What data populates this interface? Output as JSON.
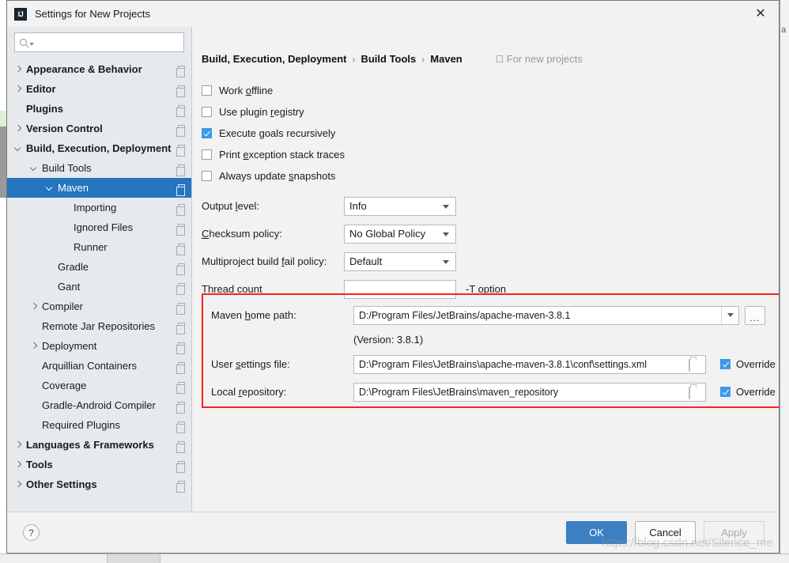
{
  "window": {
    "title": "Settings for New Projects",
    "logo_text": "IJ",
    "close_label": "✕"
  },
  "sidebar": {
    "search": {
      "placeholder": "",
      "value": "",
      "icon": "search-icon"
    },
    "items": [
      {
        "label": "Appearance & Behavior",
        "indent": 0,
        "twisty": "collapsed",
        "bold": true,
        "selected": false
      },
      {
        "label": "Editor",
        "indent": 0,
        "twisty": "collapsed",
        "bold": true,
        "selected": false
      },
      {
        "label": "Plugins",
        "indent": 0,
        "twisty": "none",
        "bold": true,
        "selected": false
      },
      {
        "label": "Version Control",
        "indent": 0,
        "twisty": "collapsed",
        "bold": true,
        "selected": false
      },
      {
        "label": "Build, Execution, Deployment",
        "indent": 0,
        "twisty": "expanded",
        "bold": true,
        "selected": false
      },
      {
        "label": "Build Tools",
        "indent": 1,
        "twisty": "expanded",
        "bold": false,
        "selected": false
      },
      {
        "label": "Maven",
        "indent": 2,
        "twisty": "expanded",
        "bold": false,
        "selected": true
      },
      {
        "label": "Importing",
        "indent": 3,
        "twisty": "none",
        "bold": false,
        "selected": false
      },
      {
        "label": "Ignored Files",
        "indent": 3,
        "twisty": "none",
        "bold": false,
        "selected": false
      },
      {
        "label": "Runner",
        "indent": 3,
        "twisty": "none",
        "bold": false,
        "selected": false
      },
      {
        "label": "Gradle",
        "indent": 2,
        "twisty": "none",
        "bold": false,
        "selected": false
      },
      {
        "label": "Gant",
        "indent": 2,
        "twisty": "none",
        "bold": false,
        "selected": false
      },
      {
        "label": "Compiler",
        "indent": 1,
        "twisty": "collapsed",
        "bold": false,
        "selected": false
      },
      {
        "label": "Remote Jar Repositories",
        "indent": 1,
        "twisty": "none",
        "bold": false,
        "selected": false
      },
      {
        "label": "Deployment",
        "indent": 1,
        "twisty": "collapsed",
        "bold": false,
        "selected": false
      },
      {
        "label": "Arquillian Containers",
        "indent": 1,
        "twisty": "none",
        "bold": false,
        "selected": false
      },
      {
        "label": "Coverage",
        "indent": 1,
        "twisty": "none",
        "bold": false,
        "selected": false
      },
      {
        "label": "Gradle-Android Compiler",
        "indent": 1,
        "twisty": "none",
        "bold": false,
        "selected": false
      },
      {
        "label": "Required Plugins",
        "indent": 1,
        "twisty": "none",
        "bold": false,
        "selected": false
      },
      {
        "label": "Languages & Frameworks",
        "indent": 0,
        "twisty": "collapsed",
        "bold": true,
        "selected": false
      },
      {
        "label": "Tools",
        "indent": 0,
        "twisty": "collapsed",
        "bold": true,
        "selected": false
      },
      {
        "label": "Other Settings",
        "indent": 0,
        "twisty": "collapsed",
        "bold": true,
        "selected": false
      }
    ]
  },
  "main": {
    "breadcrumb": {
      "part1": "Build, Execution, Deployment",
      "sep1": "›",
      "part2": "Build Tools",
      "sep2": "›",
      "part3": "Maven",
      "scope_label": "For new projects"
    },
    "checkboxes": [
      {
        "label_pre": "Work ",
        "mnemonic": "o",
        "label_post": "ffline",
        "checked": false
      },
      {
        "label_pre": "Use plugin ",
        "mnemonic": "r",
        "label_post": "egistry",
        "checked": false
      },
      {
        "label_pre": "Execute ",
        "mnemonic": "g",
        "label_post": "oals recursively",
        "checked": true
      },
      {
        "label_pre": "Print ",
        "mnemonic": "e",
        "label_post": "xception stack traces",
        "checked": false
      },
      {
        "label_pre": "Always update ",
        "mnemonic": "s",
        "label_post": "napshots",
        "checked": false
      }
    ],
    "fields": {
      "output_level": {
        "label_pre": "Output ",
        "mnemonic": "l",
        "label_post": "evel:",
        "value": "Info"
      },
      "checksum_policy": {
        "label_pre": "",
        "mnemonic": "C",
        "label_post": "hecksum policy:",
        "value": "No Global Policy"
      },
      "multiproject_fail_policy": {
        "label_pre": "Multiproject build ",
        "mnemonic": "f",
        "label_post": "ail policy:",
        "value": "Default"
      },
      "thread_count": {
        "label_pre": "Thread count",
        "mnemonic": "",
        "label_post": "",
        "value": "",
        "hint": "-T option"
      }
    },
    "maven_group": {
      "highlight_color": "#ff1f1f",
      "home_path": {
        "label_pre": "Maven ",
        "mnemonic": "h",
        "label_post": "ome path:",
        "value": "D:/Program Files/JetBrains/apache-maven-3.8.1",
        "browse_label": "..."
      },
      "version_text": "(Version: 3.8.1)",
      "user_settings_file": {
        "label_pre": "User ",
        "mnemonic": "s",
        "label_post": "ettings file:",
        "value": "D:\\Program Files\\JetBrains\\apache-maven-3.8.1\\conf\\settings.xml",
        "override_label": "Override",
        "override_checked": true
      },
      "local_repository": {
        "label_pre": "Local ",
        "mnemonic": "r",
        "label_post": "epository:",
        "value": "D:\\Program Files\\JetBrains\\maven_repository",
        "override_label": "Override",
        "override_checked": true
      }
    }
  },
  "footer": {
    "help_label": "?",
    "ok_label": "OK",
    "cancel_label": "Cancel",
    "apply_label": "Apply"
  },
  "watermark": "https://blog.csdn.net/Silence_me",
  "background": {
    "right_glyph": "a"
  }
}
